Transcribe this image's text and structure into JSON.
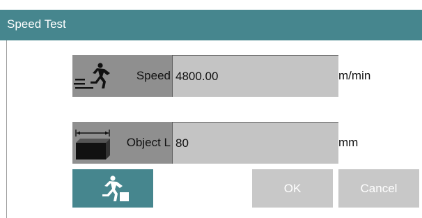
{
  "dialog": {
    "title": "Speed Test"
  },
  "fields": {
    "speed": {
      "label": "Speed",
      "value": "4800.00",
      "unit": "m/min",
      "icon": "running-speed-icon"
    },
    "object_length": {
      "label": "Object L",
      "value": "80",
      "unit": "mm",
      "icon": "object-length-icon"
    }
  },
  "buttons": {
    "run": {
      "icon": "run-test-icon"
    },
    "ok_label": "OK",
    "cancel_label": "Cancel"
  },
  "colors": {
    "accent": "#46868e",
    "label_bg": "#8f8f8f",
    "input_bg": "#c4c4c4",
    "button_disabled_bg": "#c8c8c8"
  }
}
